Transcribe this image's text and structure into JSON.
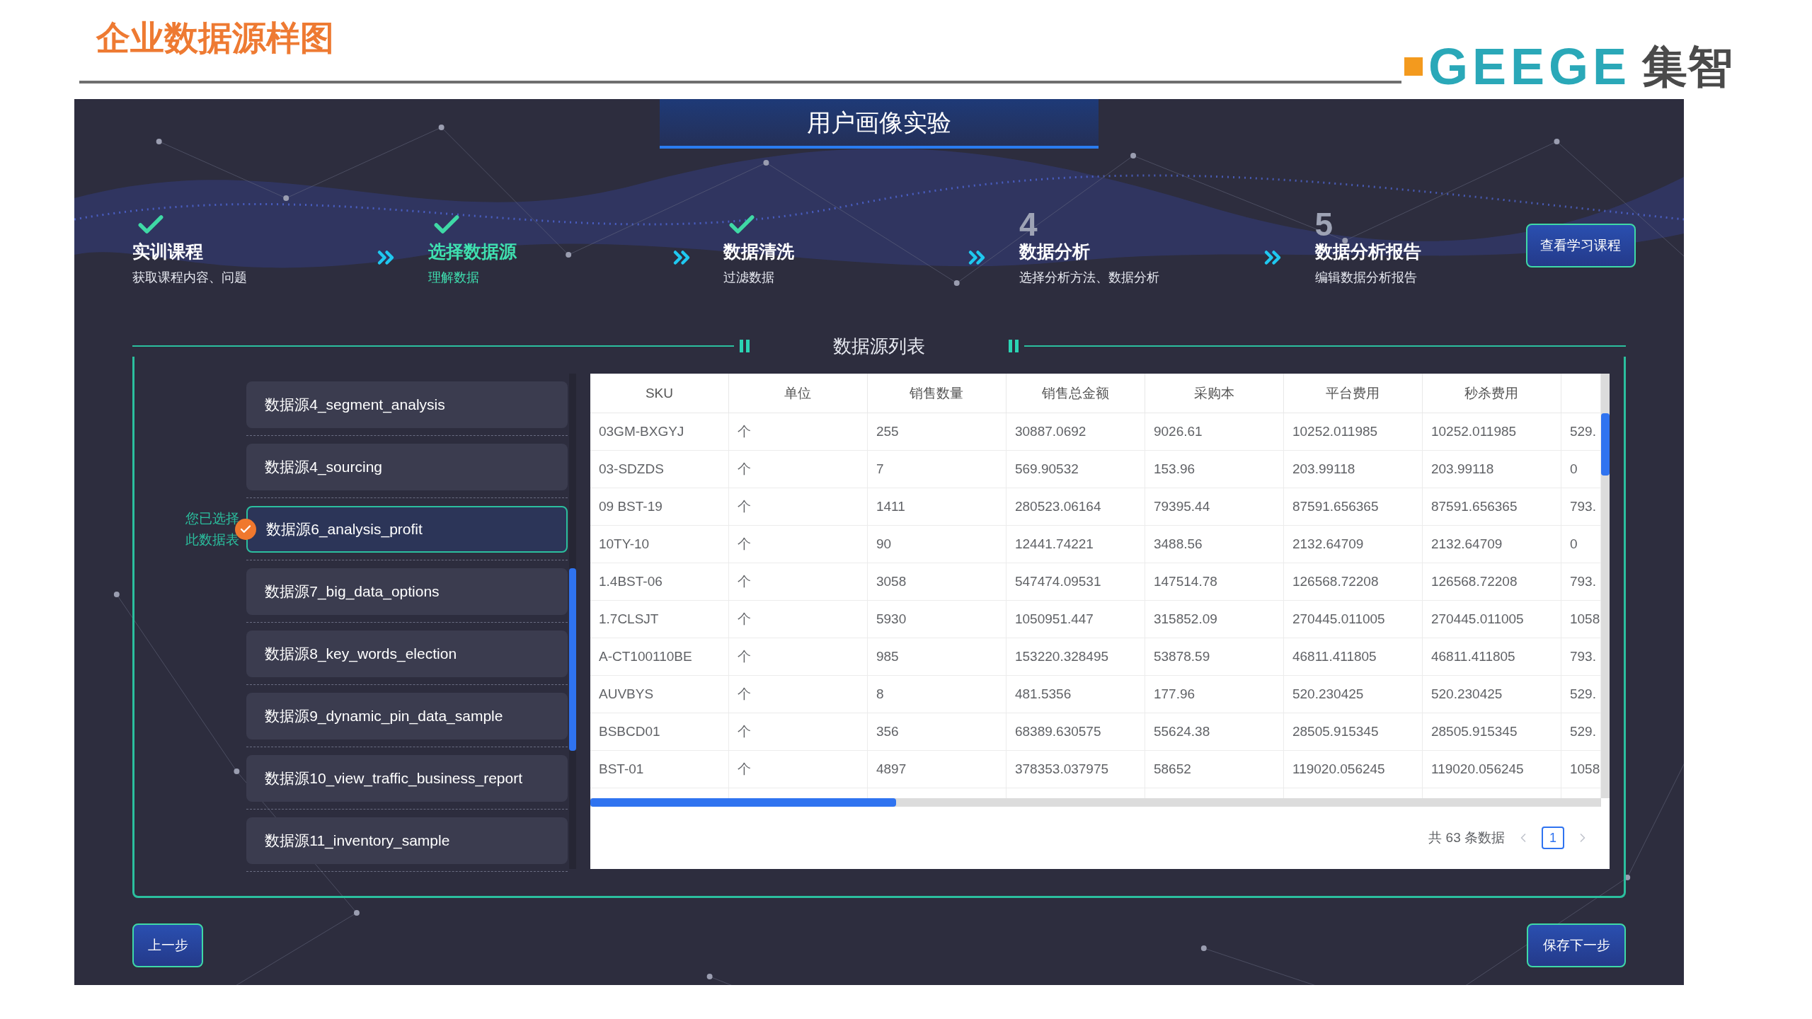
{
  "page_title": "企业数据源样图",
  "logo": {
    "text": "GEEGE",
    "suffix": "集智"
  },
  "app": {
    "title": "用户画像实验",
    "steps": [
      {
        "kind": "done",
        "title": "实训课程",
        "subtitle": "获取课程内容、问题",
        "selected": false
      },
      {
        "kind": "done",
        "title": "选择数据源",
        "subtitle": "理解数据",
        "selected": true
      },
      {
        "kind": "done",
        "title": "数据清洗",
        "subtitle": "过滤数据",
        "selected": false
      },
      {
        "kind": "number",
        "number": "4",
        "title": "数据分析",
        "subtitle": "选择分析方法、数据分析",
        "selected": false
      },
      {
        "kind": "number",
        "number": "5",
        "title": "数据分析报告",
        "subtitle": "编辑数据分析报告",
        "selected": false
      }
    ],
    "course_button": "查看学习课程",
    "panel_title": "数据源列表",
    "selected_note": "您已选择此数据表",
    "sources": [
      {
        "name": "数据源4_segment_analysis",
        "selected": false
      },
      {
        "name": "数据源4_sourcing",
        "selected": false
      },
      {
        "name": "数据源6_analysis_profit",
        "selected": true
      },
      {
        "name": "数据源7_big_data_options",
        "selected": false
      },
      {
        "name": "数据源8_key_words_election",
        "selected": false
      },
      {
        "name": "数据源9_dynamic_pin_data_sample",
        "selected": false
      },
      {
        "name": "数据源10_view_traffic_business_report",
        "selected": false
      },
      {
        "name": "数据源11_inventory_sample",
        "selected": false
      }
    ],
    "table": {
      "columns": [
        "SKU",
        "单位",
        "销售数量",
        "销售总金额",
        "采购本",
        "平台费用",
        "秒杀费用",
        ""
      ],
      "rows": [
        [
          "03GM-BXGYJ",
          "个",
          "255",
          "30887.0692",
          "9026.61",
          "10252.011985",
          "10252.011985",
          "529."
        ],
        [
          "03-SDZDS",
          "个",
          "7",
          "569.90532",
          "153.96",
          "203.99118",
          "203.99118",
          "0"
        ],
        [
          "09 BST-19",
          "个",
          "1411",
          "280523.06164",
          "79395.44",
          "87591.656365",
          "87591.656365",
          "793."
        ],
        [
          "10TY-10",
          "个",
          "90",
          "12441.74221",
          "3488.56",
          "2132.64709",
          "2132.64709",
          "0"
        ],
        [
          "1.4BST-06",
          "个",
          "3058",
          "547474.09531",
          "147514.78",
          "126568.72208",
          "126568.72208",
          "793."
        ],
        [
          "1.7CLSJT",
          "个",
          "5930",
          "1050951.447",
          "315852.09",
          "270445.011005",
          "270445.011005",
          "1058"
        ],
        [
          "A-CT100110BE",
          "个",
          "985",
          "153220.328495",
          "53878.59",
          "46811.411805",
          "46811.411805",
          "793."
        ],
        [
          "AUVBYS",
          "个",
          "8",
          "481.5356",
          "177.96",
          "520.230425",
          "520.230425",
          "529."
        ],
        [
          "BSBCD01",
          "个",
          "356",
          "68389.630575",
          "55624.38",
          "28505.915345",
          "28505.915345",
          "529."
        ],
        [
          "BST-01",
          "个",
          "4897",
          "378353.037975",
          "58652",
          "119020.056245",
          "119020.056245",
          "1058"
        ]
      ],
      "total": "共 63 条数据",
      "pages": [
        {
          "label": "1",
          "selected": true
        }
      ]
    },
    "prev_button": "上一步",
    "next_button": "保存下一步"
  }
}
